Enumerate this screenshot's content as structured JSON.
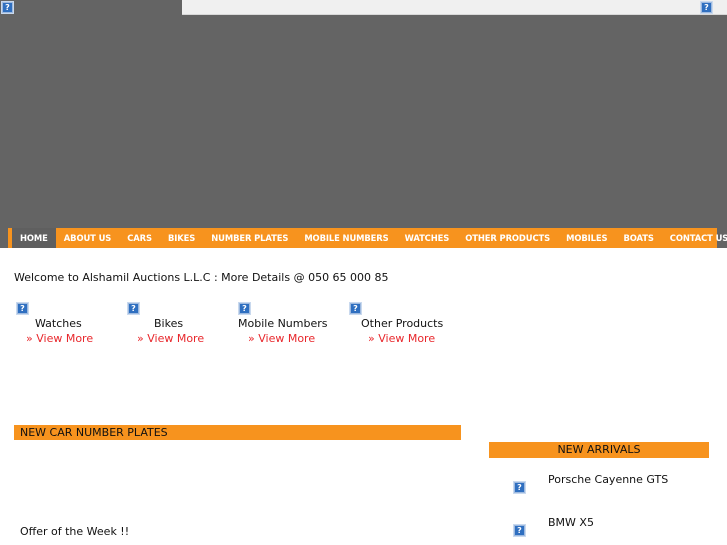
{
  "header": {
    "broken_image_glyph": "?"
  },
  "nav": {
    "items": [
      {
        "label": "HOME",
        "active": true
      },
      {
        "label": "ABOUT US",
        "active": false
      },
      {
        "label": "CARS",
        "active": false
      },
      {
        "label": "BIKES",
        "active": false
      },
      {
        "label": "NUMBER PLATES",
        "active": false
      },
      {
        "label": "MOBILE NUMBERS",
        "active": false
      },
      {
        "label": "WATCHES",
        "active": false
      },
      {
        "label": "OTHER PRODUCTS",
        "active": false
      },
      {
        "label": "MOBILES",
        "active": false
      },
      {
        "label": "BOATS",
        "active": false
      },
      {
        "label": "CONTACT US",
        "active": false
      }
    ]
  },
  "welcome": {
    "text": "Welcome to Alshamil Auctions L.L.C : More Details @ 050 65 000 85"
  },
  "categories": [
    {
      "label": "Watches",
      "link": "» View More"
    },
    {
      "label": "Bikes",
      "link": "» View More"
    },
    {
      "label": "Mobile Numbers",
      "link": "» View More"
    },
    {
      "label": "Other Products",
      "link": "» View More"
    }
  ],
  "new_plates": {
    "title": "NEW CAR NUMBER PLATES"
  },
  "arrivals": {
    "title": "NEW ARRIVALS",
    "items": [
      {
        "name": "Porsche Cayenne GTS"
      },
      {
        "name": "BMW X5"
      }
    ]
  },
  "offer": {
    "title": "Offer of the Week !!"
  },
  "colors": {
    "accent_orange": "#f7931e",
    "banner_gray": "#646464",
    "link_red": "#e8272c",
    "active_nav": "#5f5f5f"
  }
}
